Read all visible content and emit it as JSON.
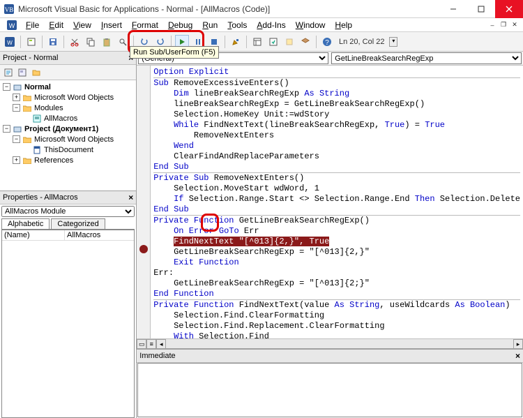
{
  "title": "Microsoft Visual Basic for Applications - Normal - [AllMacros (Code)]",
  "menu": [
    "File",
    "Edit",
    "View",
    "Insert",
    "Format",
    "Debug",
    "Run",
    "Tools",
    "Add-Ins",
    "Window",
    "Help"
  ],
  "cursor": "Ln 20, Col 22",
  "tooltip": "Run Sub/UserForm (F5)",
  "project_panel_title": "Project - Normal",
  "tree": {
    "normal": "Normal",
    "mwo": "Microsoft Word Objects",
    "modules": "Modules",
    "allmacros": "AllMacros",
    "project": "Project (Документ1)",
    "mwo2": "Microsoft Word Objects",
    "thisdoc": "ThisDocument",
    "refs": "References"
  },
  "props_title": "Properties - AllMacros",
  "props_combo": "AllMacros Module",
  "props_tabs": {
    "alpha": "Alphabetic",
    "cat": "Categorized"
  },
  "props_row": {
    "key": "(Name)",
    "val": "AllMacros"
  },
  "dd": {
    "left": "(General)",
    "right": "GetLineBreakSearchRegExp"
  },
  "code_lines": [
    {
      "t": [
        {
          "s": "Option Explicit",
          "c": "kw"
        }
      ]
    },
    {
      "div": true
    },
    {
      "t": [
        {
          "s": "Sub",
          "c": "kw"
        },
        {
          "s": " RemoveExcessiveEnters()"
        }
      ]
    },
    {
      "t": [
        {
          "s": "    "
        },
        {
          "s": "Dim",
          "c": "kw"
        },
        {
          "s": " lineBreakSearchRegExp "
        },
        {
          "s": "As String",
          "c": "kw"
        }
      ]
    },
    {
      "t": [
        {
          "s": "    lineBreakSearchRegExp = GetLineBreakSearchRegExp()"
        }
      ]
    },
    {
      "t": [
        {
          "s": ""
        }
      ]
    },
    {
      "t": [
        {
          "s": "    Selection.HomeKey Unit:=wdStory"
        }
      ]
    },
    {
      "t": [
        {
          "s": "    "
        },
        {
          "s": "While",
          "c": "kw"
        },
        {
          "s": " FindNextText(lineBreakSearchRegExp, "
        },
        {
          "s": "True",
          "c": "kw"
        },
        {
          "s": ") = "
        },
        {
          "s": "True",
          "c": "kw"
        }
      ]
    },
    {
      "t": [
        {
          "s": "        RemoveNextEnters"
        }
      ]
    },
    {
      "t": [
        {
          "s": "    "
        },
        {
          "s": "Wend",
          "c": "kw"
        }
      ]
    },
    {
      "t": [
        {
          "s": "    ClearFindAndReplaceParameters"
        }
      ]
    },
    {
      "t": [
        {
          "s": "End Sub",
          "c": "kw"
        }
      ]
    },
    {
      "div": true
    },
    {
      "t": [
        {
          "s": "Private Sub",
          "c": "kw"
        },
        {
          "s": " RemoveNextEnters()"
        }
      ]
    },
    {
      "t": [
        {
          "s": "    Selection.MoveStart wdWord, 1"
        }
      ]
    },
    {
      "t": [
        {
          "s": "    "
        },
        {
          "s": "If",
          "c": "kw"
        },
        {
          "s": " Selection.Range.Start <> Selection.Range.End "
        },
        {
          "s": "Then",
          "c": "kw"
        },
        {
          "s": " Selection.Delete"
        }
      ]
    },
    {
      "t": [
        {
          "s": "End Sub",
          "c": "kw"
        }
      ]
    },
    {
      "div": true
    },
    {
      "t": [
        {
          "s": "Private Function",
          "c": "kw"
        },
        {
          "s": " GetLineBreakSearchRegExp()"
        }
      ]
    },
    {
      "t": [
        {
          "s": "    "
        },
        {
          "s": "On Error GoTo",
          "c": "kw"
        },
        {
          "s": " Err"
        }
      ]
    },
    {
      "bp": true,
      "t": [
        {
          "s": "    "
        },
        {
          "s": "FindNextText \"[^013]{2,}\", True",
          "c": "hl-stop"
        }
      ]
    },
    {
      "t": [
        {
          "s": "    GetLineBreakSearchRegExp = \"[^013]{2,}\""
        }
      ]
    },
    {
      "t": [
        {
          "s": "    "
        },
        {
          "s": "Exit Function",
          "c": "kw"
        }
      ]
    },
    {
      "t": [
        {
          "s": ""
        }
      ]
    },
    {
      "t": [
        {
          "s": "Err:"
        }
      ]
    },
    {
      "t": [
        {
          "s": "    GetLineBreakSearchRegExp = \"[^013]{2;}\""
        }
      ]
    },
    {
      "t": [
        {
          "s": "End Function",
          "c": "kw"
        }
      ]
    },
    {
      "div": true
    },
    {
      "t": [
        {
          "s": "Private Function",
          "c": "kw"
        },
        {
          "s": " FindNextText(value "
        },
        {
          "s": "As String",
          "c": "kw"
        },
        {
          "s": ", useWildcards "
        },
        {
          "s": "As Boolean",
          "c": "kw"
        },
        {
          "s": ")"
        }
      ]
    },
    {
      "t": [
        {
          "s": "    Selection.Find.ClearFormatting"
        }
      ]
    },
    {
      "t": [
        {
          "s": "    Selection.Find.Replacement.ClearFormatting"
        }
      ]
    },
    {
      "t": [
        {
          "s": "    "
        },
        {
          "s": "With",
          "c": "kw"
        },
        {
          "s": " Selection.Find"
        }
      ]
    }
  ],
  "immediate_title": "Immediate"
}
